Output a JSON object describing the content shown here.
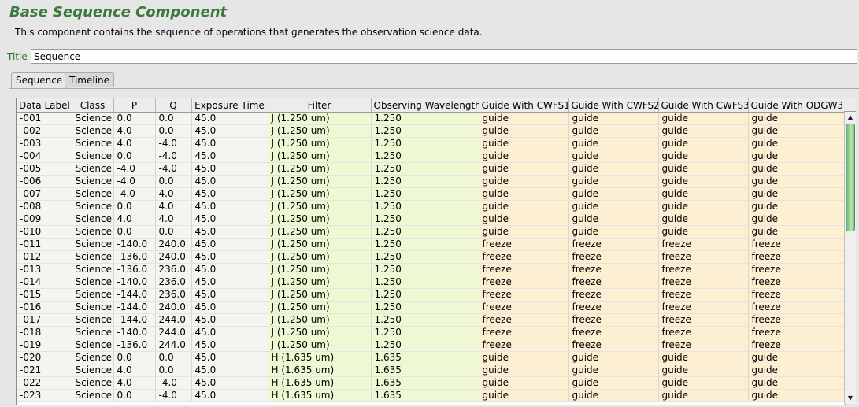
{
  "component": {
    "title": "Base Sequence Component",
    "description": "This component contains the sequence of operations that generates the observation science data."
  },
  "title_field": {
    "label": "Title",
    "value": "Sequence"
  },
  "tabs": [
    {
      "label": "Sequence",
      "active": true
    },
    {
      "label": "Timeline",
      "active": false
    }
  ],
  "table": {
    "columns": [
      "Data Label",
      "Class",
      "P",
      "Q",
      "Exposure Time",
      "Filter",
      "Observing Wavelength",
      "Guide With CWFS1",
      "Guide With CWFS2",
      "Guide With CWFS3",
      "Guide With ODGW3"
    ],
    "rows": [
      [
        "-001",
        "Science",
        "0.0",
        "0.0",
        "45.0",
        "J (1.250 um)",
        "1.250",
        "guide",
        "guide",
        "guide",
        "guide"
      ],
      [
        "-002",
        "Science",
        "4.0",
        "0.0",
        "45.0",
        "J (1.250 um)",
        "1.250",
        "guide",
        "guide",
        "guide",
        "guide"
      ],
      [
        "-003",
        "Science",
        "4.0",
        "-4.0",
        "45.0",
        "J (1.250 um)",
        "1.250",
        "guide",
        "guide",
        "guide",
        "guide"
      ],
      [
        "-004",
        "Science",
        "0.0",
        "-4.0",
        "45.0",
        "J (1.250 um)",
        "1.250",
        "guide",
        "guide",
        "guide",
        "guide"
      ],
      [
        "-005",
        "Science",
        "-4.0",
        "-4.0",
        "45.0",
        "J (1.250 um)",
        "1.250",
        "guide",
        "guide",
        "guide",
        "guide"
      ],
      [
        "-006",
        "Science",
        "-4.0",
        "0.0",
        "45.0",
        "J (1.250 um)",
        "1.250",
        "guide",
        "guide",
        "guide",
        "guide"
      ],
      [
        "-007",
        "Science",
        "-4.0",
        "4.0",
        "45.0",
        "J (1.250 um)",
        "1.250",
        "guide",
        "guide",
        "guide",
        "guide"
      ],
      [
        "-008",
        "Science",
        "0.0",
        "4.0",
        "45.0",
        "J (1.250 um)",
        "1.250",
        "guide",
        "guide",
        "guide",
        "guide"
      ],
      [
        "-009",
        "Science",
        "4.0",
        "4.0",
        "45.0",
        "J (1.250 um)",
        "1.250",
        "guide",
        "guide",
        "guide",
        "guide"
      ],
      [
        "-010",
        "Science",
        "0.0",
        "0.0",
        "45.0",
        "J (1.250 um)",
        "1.250",
        "guide",
        "guide",
        "guide",
        "guide"
      ],
      [
        "-011",
        "Science",
        "-140.0",
        "240.0",
        "45.0",
        "J (1.250 um)",
        "1.250",
        "freeze",
        "freeze",
        "freeze",
        "freeze"
      ],
      [
        "-012",
        "Science",
        "-136.0",
        "240.0",
        "45.0",
        "J (1.250 um)",
        "1.250",
        "freeze",
        "freeze",
        "freeze",
        "freeze"
      ],
      [
        "-013",
        "Science",
        "-136.0",
        "236.0",
        "45.0",
        "J (1.250 um)",
        "1.250",
        "freeze",
        "freeze",
        "freeze",
        "freeze"
      ],
      [
        "-014",
        "Science",
        "-140.0",
        "236.0",
        "45.0",
        "J (1.250 um)",
        "1.250",
        "freeze",
        "freeze",
        "freeze",
        "freeze"
      ],
      [
        "-015",
        "Science",
        "-144.0",
        "236.0",
        "45.0",
        "J (1.250 um)",
        "1.250",
        "freeze",
        "freeze",
        "freeze",
        "freeze"
      ],
      [
        "-016",
        "Science",
        "-144.0",
        "240.0",
        "45.0",
        "J (1.250 um)",
        "1.250",
        "freeze",
        "freeze",
        "freeze",
        "freeze"
      ],
      [
        "-017",
        "Science",
        "-144.0",
        "244.0",
        "45.0",
        "J (1.250 um)",
        "1.250",
        "freeze",
        "freeze",
        "freeze",
        "freeze"
      ],
      [
        "-018",
        "Science",
        "-140.0",
        "244.0",
        "45.0",
        "J (1.250 um)",
        "1.250",
        "freeze",
        "freeze",
        "freeze",
        "freeze"
      ],
      [
        "-019",
        "Science",
        "-136.0",
        "244.0",
        "45.0",
        "J (1.250 um)",
        "1.250",
        "freeze",
        "freeze",
        "freeze",
        "freeze"
      ],
      [
        "-020",
        "Science",
        "0.0",
        "0.0",
        "45.0",
        "H (1.635 um)",
        "1.635",
        "guide",
        "guide",
        "guide",
        "guide"
      ],
      [
        "-021",
        "Science",
        "4.0",
        "0.0",
        "45.0",
        "H (1.635 um)",
        "1.635",
        "guide",
        "guide",
        "guide",
        "guide"
      ],
      [
        "-022",
        "Science",
        "4.0",
        "-4.0",
        "45.0",
        "H (1.635 um)",
        "1.635",
        "guide",
        "guide",
        "guide",
        "guide"
      ],
      [
        "-023",
        "Science",
        "0.0",
        "-4.0",
        "45.0",
        "H (1.635 um)",
        "1.635",
        "guide",
        "guide",
        "guide",
        "guide"
      ]
    ]
  },
  "scrollbar": {
    "up_icon": "arrow-up-icon",
    "down_icon": "arrow-down-icon",
    "position": 0.0
  },
  "colors": {
    "title": "#3a7a3a",
    "filter_cells": "#eef8d2",
    "guide_cells": "#fdf0d2",
    "scroll_thumb": "#8fce8f"
  }
}
